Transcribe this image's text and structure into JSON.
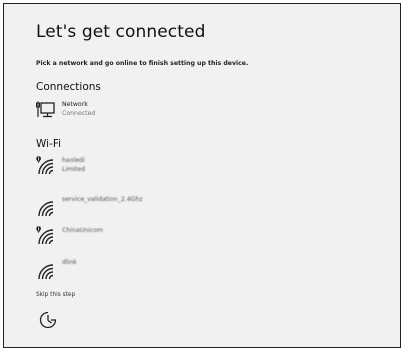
{
  "page": {
    "title": "Let's get connected",
    "subtitle": "Pick a network and go online to finish setting up this device."
  },
  "connections": {
    "heading": "Connections",
    "items": [
      {
        "name": "Network",
        "status": "Connected",
        "icon": "ethernet-icon"
      }
    ]
  },
  "wifi": {
    "heading": "Wi-Fi",
    "items": [
      {
        "name": "haoledi",
        "status": "Limited",
        "secured_warning": true,
        "icon": "wifi-warning-icon"
      },
      {
        "name": "service_validation_2.4Ghz",
        "status": "",
        "secured_warning": false,
        "icon": "wifi-icon"
      },
      {
        "name": "ChinaUnicom",
        "status": "",
        "secured_warning": true,
        "icon": "wifi-warning-icon"
      },
      {
        "name": "dlink",
        "status": "",
        "secured_warning": false,
        "icon": "wifi-icon"
      }
    ]
  },
  "footer": {
    "skip_label": "Skip this step",
    "accessibility_icon": "ease-of-access-icon"
  }
}
